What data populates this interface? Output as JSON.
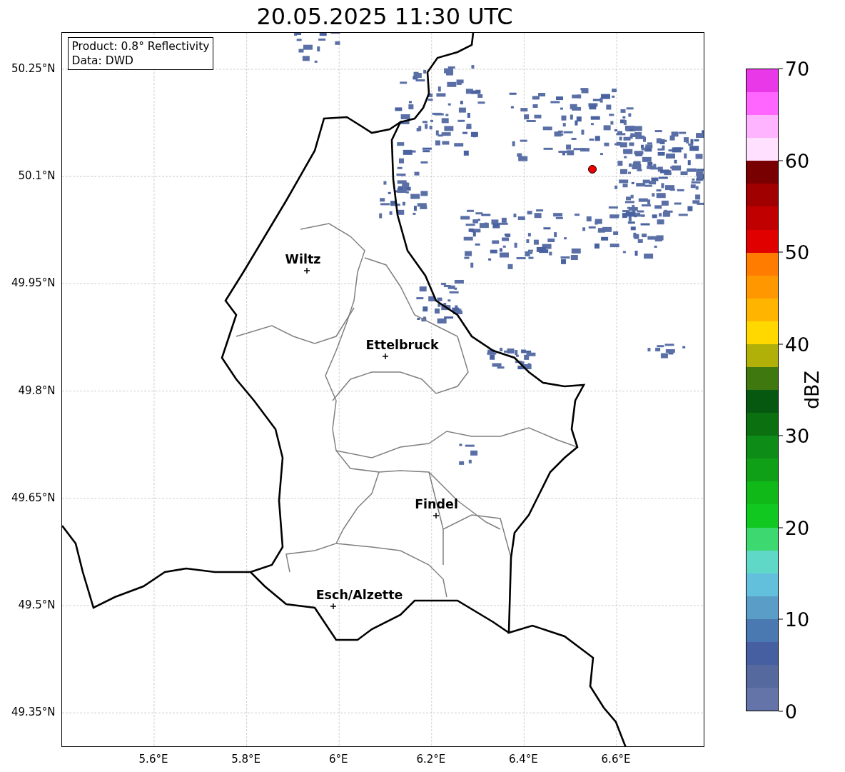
{
  "title": "20.05.2025 11:30 UTC",
  "info_box": {
    "lines": [
      "Product: 0.8° Reflectivity",
      "Data: DWD"
    ]
  },
  "map": {
    "lat_ticks": [
      "50.25°N",
      "50.1°N",
      "49.95°N",
      "49.8°N",
      "49.65°N",
      "49.5°N",
      "49.35°N"
    ],
    "lon_ticks": [
      "5.6°E",
      "5.8°E",
      "6°E",
      "6.2°E",
      "6.4°E",
      "6.6°E"
    ],
    "cities": [
      {
        "name": "Wiltz"
      },
      {
        "name": "Ettelbruck"
      },
      {
        "name": "Findel"
      },
      {
        "name": "Esch/Alzette"
      }
    ]
  },
  "colorbar": {
    "label": "dBZ",
    "ticks": [
      "70",
      "60",
      "50",
      "40",
      "30",
      "20",
      "10",
      "0"
    ],
    "segments": [
      {
        "color": "#e838e8"
      },
      {
        "color": "#ff66ff"
      },
      {
        "color": "#ffb4ff"
      },
      {
        "color": "#ffe0ff"
      },
      {
        "color": "#780000"
      },
      {
        "color": "#a00000"
      },
      {
        "color": "#c00000"
      },
      {
        "color": "#e00000"
      },
      {
        "color": "#ff7c00"
      },
      {
        "color": "#ff9800"
      },
      {
        "color": "#ffb400"
      },
      {
        "color": "#ffd800"
      },
      {
        "color": "#b0b008"
      },
      {
        "color": "#407810"
      },
      {
        "color": "#065810"
      },
      {
        "color": "#0a7010"
      },
      {
        "color": "#0e8c18"
      },
      {
        "color": "#10a018"
      },
      {
        "color": "#10b818"
      },
      {
        "color": "#10c820"
      },
      {
        "color": "#3ed870"
      },
      {
        "color": "#60d8c8"
      },
      {
        "color": "#63c0dc"
      },
      {
        "color": "#5a9ec8"
      },
      {
        "color": "#4a78b0"
      },
      {
        "color": "#455fa0"
      },
      {
        "color": "#56699e"
      },
      {
        "color": "#6474a8"
      }
    ]
  }
}
